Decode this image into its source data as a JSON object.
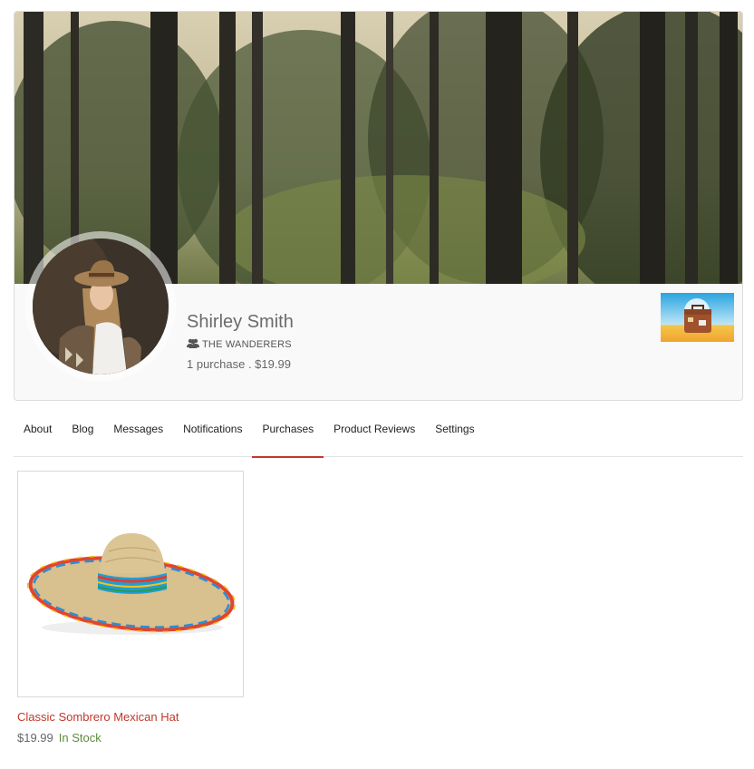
{
  "profile": {
    "name": "Shirley Smith",
    "group": "THE WANDERERS",
    "purchases_count": "1 purchase",
    "separator": " . ",
    "purchases_total": "$19.99"
  },
  "tabs": [
    {
      "label": "About",
      "active": false
    },
    {
      "label": "Blog",
      "active": false
    },
    {
      "label": "Messages",
      "active": false
    },
    {
      "label": "Notifications",
      "active": false
    },
    {
      "label": "Purchases",
      "active": true
    },
    {
      "label": "Product Reviews",
      "active": false
    },
    {
      "label": "Settings",
      "active": false
    }
  ],
  "product": {
    "title": "Classic Sombrero Mexican Hat",
    "price": "$19.99",
    "stock": "In Stock"
  },
  "icons": {
    "group": "users-icon"
  },
  "colors": {
    "accent": "#c0392b",
    "in_stock": "#5b8c3a",
    "name_text": "#6b6b6b"
  }
}
